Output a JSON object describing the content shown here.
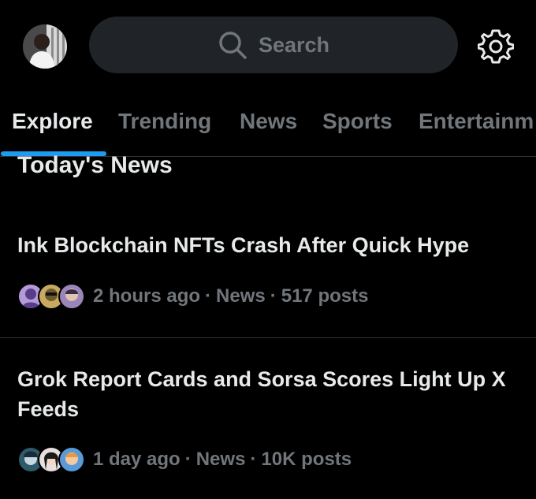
{
  "header": {
    "search_placeholder": "Search",
    "avatar_icon": "profile-avatar",
    "settings_icon": "gear-icon"
  },
  "tabs": [
    {
      "label": "Explore",
      "active": true
    },
    {
      "label": "Trending",
      "active": false
    },
    {
      "label": "News",
      "active": false
    },
    {
      "label": "Sports",
      "active": false
    },
    {
      "label": "Entertainm",
      "active": false
    }
  ],
  "section": {
    "title": "Today's News"
  },
  "news": [
    {
      "title": "Ink Blockchain NFTs Crash After Quick Hype",
      "time": "2 hours ago",
      "category": "News",
      "posts": "517 posts"
    },
    {
      "title": "Grok Report Cards and Sorsa Scores Light Up X Feeds",
      "time": "1 day ago",
      "category": "News",
      "posts": "10K posts"
    }
  ],
  "colors": {
    "background": "#000000",
    "text_primary": "#e7e9ea",
    "text_secondary": "#71767b",
    "accent": "#1d9bf0",
    "search_bg": "#202327",
    "divider": "#2f3336"
  }
}
